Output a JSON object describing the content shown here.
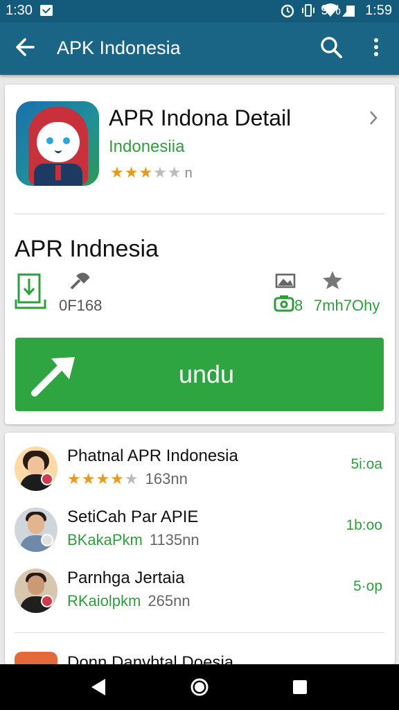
{
  "status_bar": {
    "time_left": "1:30",
    "battery_pct": "9%",
    "time_right": "1:59",
    "icons": [
      "message-icon",
      "alarm-icon",
      "vibrate-icon",
      "wifi-icon",
      "signal-icon",
      "battery-icon"
    ]
  },
  "app_bar": {
    "title": "APK Indonesia",
    "icons": [
      "back-arrow-icon",
      "search-icon",
      "more-vert-icon"
    ]
  },
  "detail": {
    "app_name": "APR Indona Detail",
    "publisher": "Indonesiia",
    "rating_stars": "★★★",
    "rating_stars_muted": "★★",
    "rating_count": "n",
    "heading": "APR Indnesia",
    "meta": {
      "left_value": "0F168",
      "right_value_prefix": "8",
      "right_value": "7mh7Ohy"
    },
    "install_label": "undu"
  },
  "list": {
    "items": [
      {
        "title": "Phatnal APR Indonesia",
        "stars": "★★★★",
        "stars_muted": "★",
        "sub": "163nn",
        "size": "5i:oa",
        "sub_type": "stars"
      },
      {
        "title": "SetiCah Par APIE",
        "green": "BKakaPkm",
        "sub": "1135nn",
        "size": "1b:oo",
        "sub_type": "green"
      },
      {
        "title": "Parnhga Jertaia",
        "green": "RKaiolpkm",
        "sub": "265nn",
        "size": "5·op",
        "sub_type": "green"
      }
    ],
    "partial_title": "Donn Danvhtal Doesia"
  },
  "colors": {
    "app_bar": "#1a6586",
    "status_bar": "#145a7a",
    "accent_green": "#2ea540",
    "star": "#e89a1c"
  }
}
